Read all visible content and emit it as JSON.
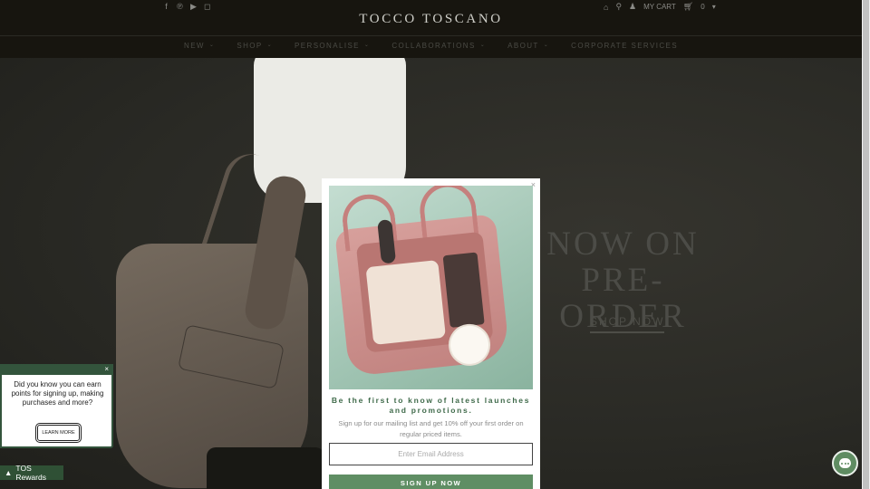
{
  "header": {
    "social_icons": [
      "facebook-icon",
      "pinterest-icon",
      "youtube-icon",
      "instagram-icon"
    ],
    "logo": "TOCCO TOSCANO",
    "utility": {
      "account_label": "MY CART",
      "cart_count": "0",
      "icons": [
        "store-icon",
        "search-icon",
        "user-icon",
        "cart-icon"
      ]
    },
    "nav": [
      {
        "label": "NEW",
        "dropdown": true
      },
      {
        "label": "SHOP",
        "dropdown": true
      },
      {
        "label": "PERSONALISE",
        "dropdown": true
      },
      {
        "label": "COLLABORATIONS",
        "dropdown": true
      },
      {
        "label": "ABOUT",
        "dropdown": true
      },
      {
        "label": "CORPORATE SERVICES",
        "dropdown": false
      }
    ]
  },
  "hero": {
    "title_line1": "NOW ON",
    "title_line2": "PRE-ORDER",
    "cta": "SHOP NOW"
  },
  "popup": {
    "close": "×",
    "heading": "Be the first to know of latest launches and promotions.",
    "subtext": "Sign up for our mailing list and get 10% off your first order on regular priced items.",
    "email_placeholder": "Enter Email Address",
    "button": "SIGN UP NOW"
  },
  "rewards": {
    "close": "×",
    "message": "Did you know you can earn points for signing up, making purchases and more?",
    "learn_more": "LEARN MORE",
    "bar_label": "TOS Rewards"
  },
  "colors": {
    "brand_green": "#5f8e64",
    "rewards_green": "#2f5035",
    "header_bg": "#17150f"
  }
}
